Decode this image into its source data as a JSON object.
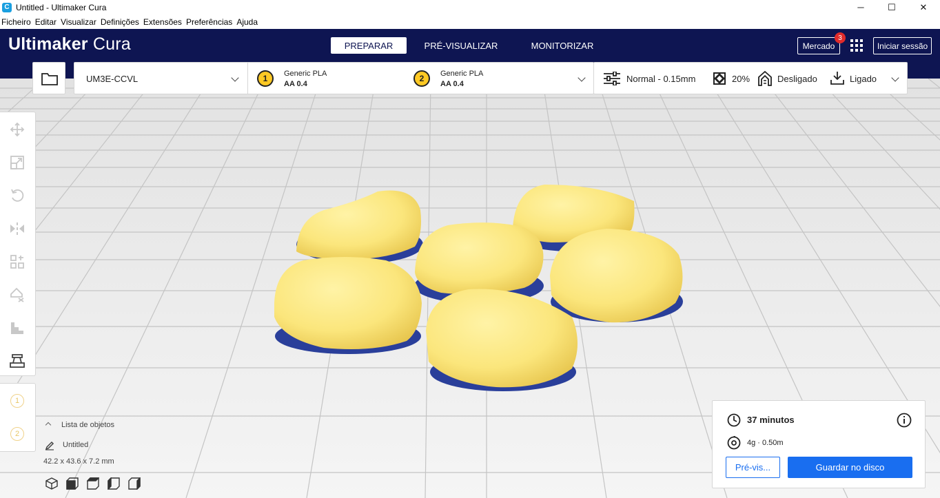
{
  "window": {
    "title": "Untitled - Ultimaker Cura",
    "app_icon": "C",
    "controls": {
      "minimize": "─",
      "maximize": "☐",
      "close": "✕"
    }
  },
  "menu": [
    "Ficheiro",
    "Editar",
    "Visualizar",
    "Definições",
    "Extensões",
    "Preferências",
    "Ajuda"
  ],
  "header": {
    "logo_brand": "Ultimaker",
    "logo_product": "Cura",
    "stages": [
      "PREPARAR",
      "PRÉ-VISUALIZAR",
      "MONITORIZAR"
    ],
    "active_stage": "PREPARAR",
    "marketplace_label": "Mercado",
    "marketplace_badge": "3",
    "signin_label": "Iniciar sessão",
    "bg_color": "#0e1552"
  },
  "printer": {
    "name": "UM3E-CCVL",
    "extruders": [
      {
        "number": "1",
        "material": "Generic PLA",
        "nozzle": "AA 0.4"
      },
      {
        "number": "2",
        "material": "Generic PLA",
        "nozzle": "AA 0.4"
      }
    ]
  },
  "print_settings": {
    "profile": "Normal - 0.15mm",
    "infill": "20%",
    "support": "Desligado",
    "adhesion": "Ligado"
  },
  "left_tools": [
    "move-icon",
    "scale-icon",
    "rotate-icon",
    "mirror-icon",
    "per-model-settings-icon",
    "support-blocker-icon",
    "layer-icon",
    "build-plate-icon"
  ],
  "extruder_selector": [
    "1",
    "2"
  ],
  "object_list": {
    "header": "Lista de objetos",
    "job_name": "Untitled",
    "dimensions": "42.2 x 43.6 x 7.2 mm"
  },
  "print_summary": {
    "time": "37 minutos",
    "material": "4g · 0.50m",
    "preview_button": "Pré-vis...",
    "save_button": "Guardar no disco"
  },
  "colors": {
    "accent_blue": "#196ef0",
    "model_yellow": "#fbe67c",
    "extruder_yellow": "#ffc924"
  }
}
